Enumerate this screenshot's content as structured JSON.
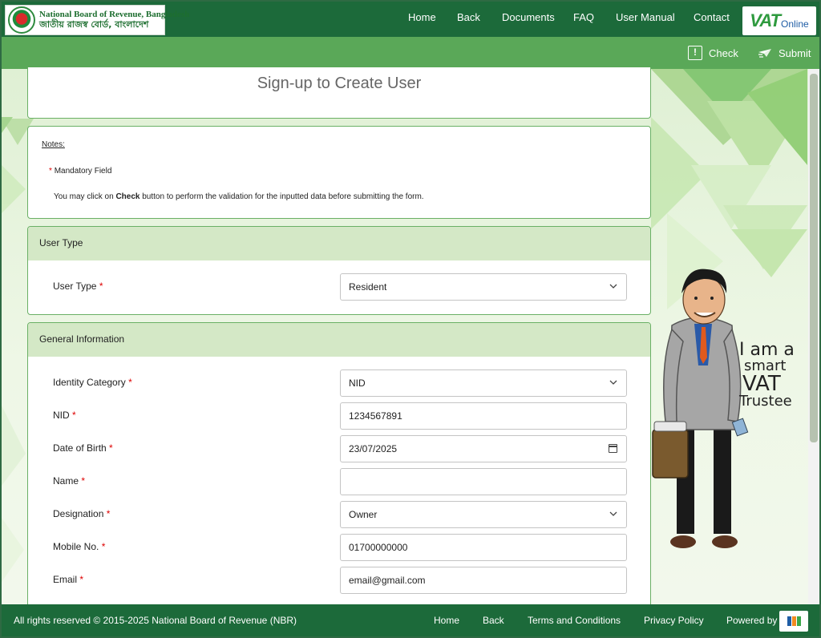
{
  "header": {
    "org_name_en": "National Board of Revenue, Bangladesh",
    "org_name_bn": "জাতীয় রাজস্ব বোর্ড, বাংলাদেশ",
    "nav": [
      "Home",
      "Back",
      "Documents",
      "FAQ",
      "User Manual",
      "Contact"
    ],
    "brand_logo_main": "VAT",
    "brand_logo_sub": "Online"
  },
  "toolbar": {
    "check_label": "Check",
    "submit_label": "Submit"
  },
  "page": {
    "title": "Sign-up to Create User"
  },
  "notes": {
    "heading": "Notes:",
    "mandatory_marker": "*",
    "mandatory_text": "Mandatory Field",
    "info_prefix": "You may click on ",
    "info_bold": "Check",
    "info_suffix": " button to perform the validation for the inputted data before submitting the form."
  },
  "user_type": {
    "heading": "User Type",
    "label": "User Type",
    "value": "Resident"
  },
  "general_info": {
    "heading": "General Information",
    "fields": {
      "identity_category": {
        "label": "Identity Category",
        "value": "NID"
      },
      "nid": {
        "label": "NID",
        "value": "1234567891"
      },
      "dob": {
        "label": "Date of Birth",
        "value": "23/07/2025"
      },
      "name": {
        "label": "Name",
        "value": ""
      },
      "designation": {
        "label": "Designation",
        "value": "Owner"
      },
      "mobile": {
        "label": "Mobile No.",
        "value": "01700000000"
      },
      "email": {
        "label": "Email",
        "value": "email@gmail.com"
      }
    }
  },
  "mascot": {
    "caption_1": "I am a",
    "caption_2": "smart",
    "caption_3": "VAT",
    "caption_4": "Trustee"
  },
  "footer": {
    "copyright": "All rights reserved © 2015-2025 National Board of Revenue (NBR)",
    "links": [
      "Home",
      "Back",
      "Terms and Conditions",
      "Privacy Policy"
    ],
    "powered_by": "Powered by",
    "powered_logo": "FPT"
  },
  "colors": {
    "nav_green": "#1c6a3a",
    "toolbar_green": "#5aa858",
    "section_header": "#d4e8c6",
    "required": "#dd0000"
  }
}
